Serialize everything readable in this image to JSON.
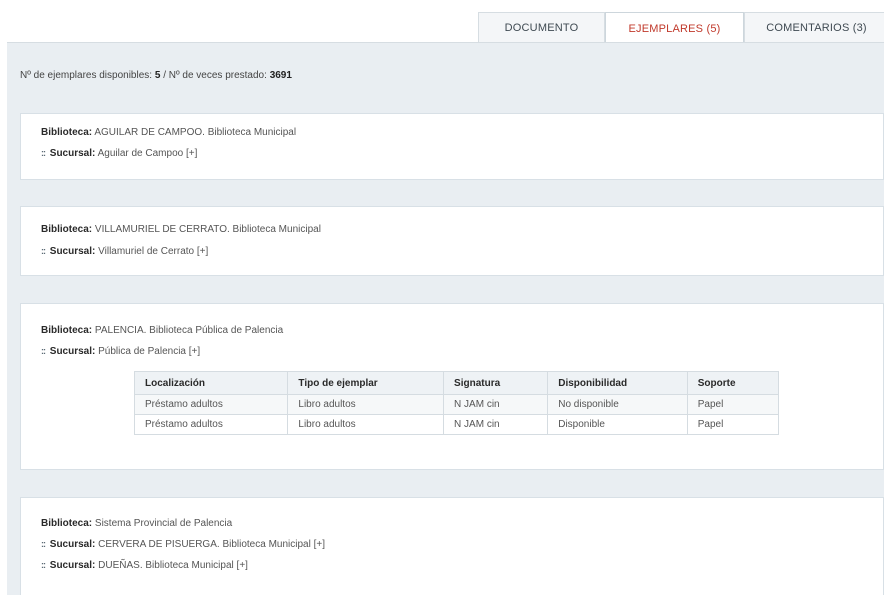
{
  "tabs": [
    {
      "label": "DOCUMENTO"
    },
    {
      "label": "EJEMPLARES (5)"
    },
    {
      "label": "COMENTARIOS (3)"
    }
  ],
  "summary": {
    "available_label": "Nº de ejemplares disponibles:",
    "available_value": "5",
    "separator": "/",
    "loaned_label": "Nº de veces prestado:",
    "loaned_value": "3691"
  },
  "labels": {
    "biblioteca": "Biblioteca:",
    "sucursal": "Sucursal:",
    "grip": "::",
    "expand": "[+]"
  },
  "libraries": [
    {
      "name": "AGUILAR DE CAMPOO. Biblioteca Municipal",
      "branches": [
        "Aguilar de Campoo"
      ]
    },
    {
      "name": "VILLAMURIEL DE CERRATO. Biblioteca Municipal",
      "branches": [
        "Villamuriel de Cerrato"
      ]
    },
    {
      "name": "PALENCIA. Biblioteca Pública de Palencia",
      "branches": [
        "Pública de Palencia"
      ],
      "table": {
        "headers": [
          "Localización",
          "Tipo de ejemplar",
          "Signatura",
          "Disponibilidad",
          "Soporte"
        ],
        "rows": [
          [
            "Préstamo adultos",
            "Libro adultos",
            "N JAM cin",
            "No disponible",
            "Papel"
          ],
          [
            "Préstamo adultos",
            "Libro adultos",
            "N JAM cin",
            "Disponible",
            "Papel"
          ]
        ]
      }
    },
    {
      "name": "Sistema Provincial de Palencia",
      "branches": [
        "CERVERA DE PISUERGA. Biblioteca Municipal",
        "DUEÑAS. Biblioteca Municipal"
      ]
    }
  ],
  "colors": {
    "active_tab": "#c0392b",
    "panel_bg": "#e9eef2"
  }
}
